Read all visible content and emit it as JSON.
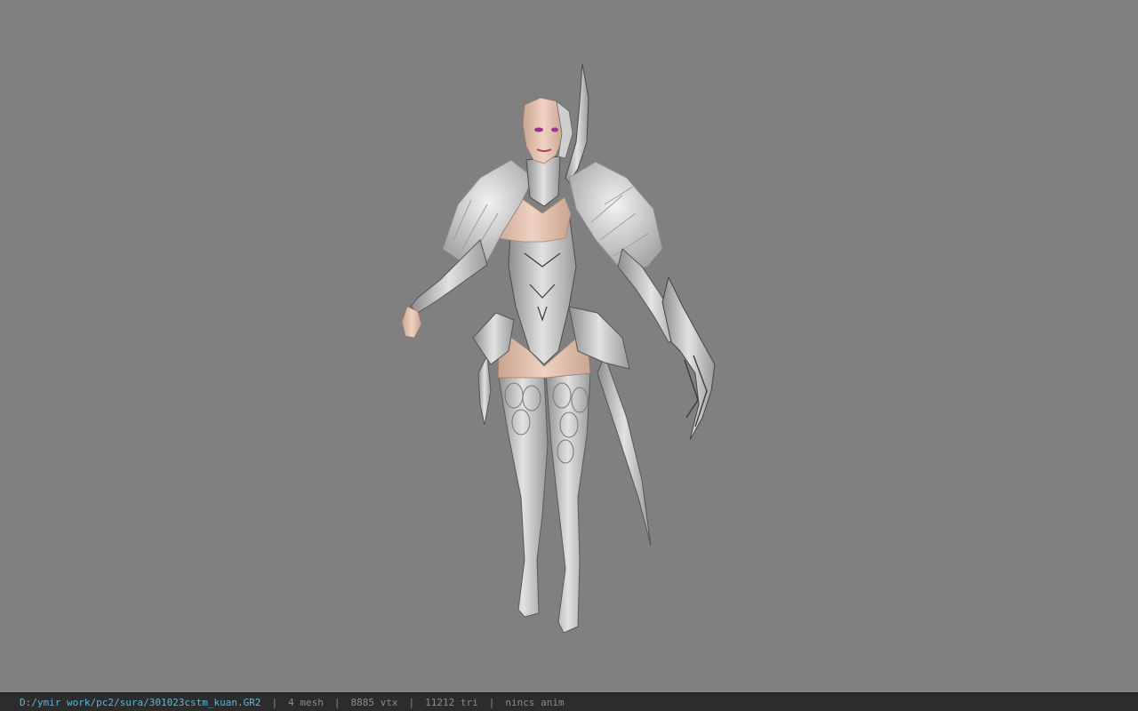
{
  "viewport": {
    "background_color": "#808080",
    "model": {
      "icon": "character-model",
      "skin_color": "#e8c4b0",
      "armor_color": "#d6d6d6",
      "armor_shadow_color": "#6e6e6e",
      "feather_color": "#e4e4e4",
      "eye_color": "#a0309a"
    }
  },
  "status_bar": {
    "file_path": "D:/ymir work/pc2/sura/301023cstm_kuan.GR2",
    "separator": "|",
    "mesh_count": "4 mesh",
    "vertex_count": "8885 vtx",
    "triangle_count": "11212 tri",
    "animation": "nincs anim",
    "path_color": "#5fb6d8",
    "background_color": "#2c2c2c"
  }
}
